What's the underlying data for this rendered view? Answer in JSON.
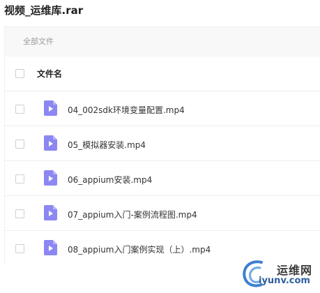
{
  "header": {
    "title": "视频_运维库.rar"
  },
  "breadcrumb": {
    "label": "全部文件"
  },
  "table": {
    "column_header": "文件名",
    "rows": [
      {
        "name": "04_002sdk环境变量配置.mp4",
        "icon": "video-file-icon"
      },
      {
        "name": "05_模拟器安装.mp4",
        "icon": "video-file-icon"
      },
      {
        "name": "06_appium安装.mp4",
        "icon": "video-file-icon"
      },
      {
        "name": "07_appium入门-案例流程图.mp4",
        "icon": "video-file-icon"
      },
      {
        "name": "08_appium入门案例实现（上）.mp4",
        "icon": "video-file-icon"
      }
    ]
  },
  "watermark": {
    "top": "运维网",
    "bottom": "iyunv.com"
  },
  "colors": {
    "icon": "#8c87f2",
    "icon_fold": "#b7b3f7",
    "text": "#333333",
    "muted": "#9a9a9a"
  }
}
